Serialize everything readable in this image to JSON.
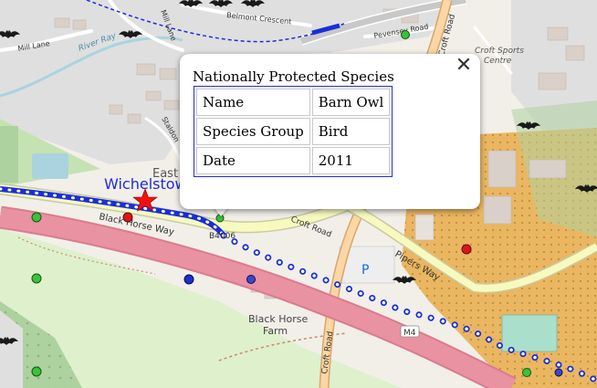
{
  "map": {
    "labels": {
      "wichelstowe": "Wichelstowe",
      "east": "East",
      "black_horse_way": "Black Horse Way",
      "b4006": "B4006",
      "croft_road_upper": "Croft Road",
      "croft_road_lower": "Croft Road",
      "pipers_way": "Pipers Way",
      "black_horse_farm_1": "Black Horse",
      "black_horse_farm_2": "Farm",
      "m4": "M4",
      "parking": "P",
      "mill_lane": "Mill Lane",
      "river_ray": "River Ray",
      "mill_lane_vert": "Mill Lane",
      "belmont_crescent": "Belmont Crescent",
      "pevensey_road": "Pevensey Road",
      "croft_sports_centre_1": "Croft Sports",
      "croft_sports_centre_2": "Centre",
      "staldon": "Staldon",
      "croft_road_top": "Croft Road"
    },
    "colors": {
      "background": "#f2efe9",
      "motorway": "#e892a2",
      "motorway_casing": "#dc7b8e",
      "primary_road": "#fcd6a4",
      "secondary_road": "#f7fabf",
      "woodland": "#aed1a0",
      "residential": "#e0dfdf",
      "water": "#aad3df",
      "route": "#1a2ed8",
      "orange_zone": "#e8a23c",
      "marker_green": "#3cc13c",
      "marker_red": "#e01616",
      "marker_blue": "#1c2fc9",
      "star": "#ee1111"
    },
    "markers": [
      {
        "kind": "green-circle-marker"
      },
      {
        "kind": "green-circle-marker"
      },
      {
        "kind": "green-circle-marker"
      },
      {
        "kind": "green-circle-marker"
      },
      {
        "kind": "green-circle-marker"
      },
      {
        "kind": "red-circle-marker"
      },
      {
        "kind": "red-circle-marker"
      },
      {
        "kind": "blue-circle-marker"
      },
      {
        "kind": "blue-circle-marker"
      }
    ],
    "icons": [
      "bat-icon",
      "star-marker-icon"
    ]
  },
  "popup": {
    "title": "Nationally Protected Species",
    "close_glyph": "✕",
    "rows": [
      {
        "key": "Name",
        "value": "Barn Owl"
      },
      {
        "key": "Species Group",
        "value": "Bird"
      },
      {
        "key": "Date",
        "value": "2011"
      }
    ]
  }
}
